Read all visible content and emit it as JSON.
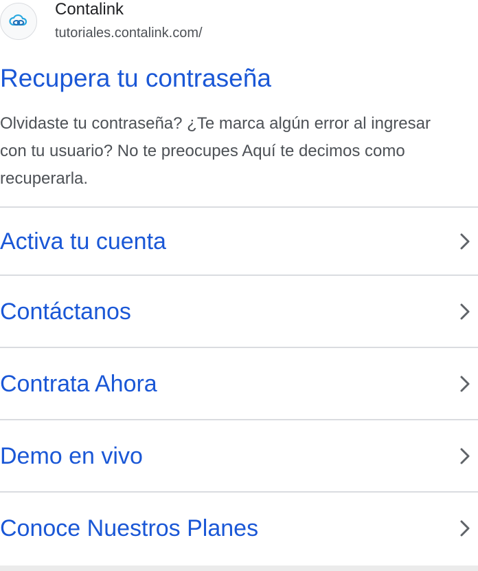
{
  "site": {
    "name": "Contalink",
    "url": "tutoriales.contalink.com/",
    "favicon_icon": "cloud-link-icon"
  },
  "result": {
    "title": "Recupera tu contraseña",
    "snippet": "Olvidaste tu contraseña? ¿Te marca algún error al ingresar con tu usuario? No te preocupes Aquí te decimos como recuperarla."
  },
  "sitelinks": [
    {
      "label": "Activa tu cuenta",
      "icon": "chevron-right-icon"
    },
    {
      "label": "Contáctanos",
      "icon": "chevron-right-icon"
    },
    {
      "label": "Contrata Ahora",
      "icon": "chevron-right-icon"
    },
    {
      "label": "Demo en vivo",
      "icon": "chevron-right-icon"
    },
    {
      "label": "Conoce Nuestros Planes",
      "icon": "chevron-right-icon"
    }
  ],
  "colors": {
    "link": "#1a57d6",
    "text": "#4d5156",
    "divider": "#dadce0",
    "favicon_accent": "#29a8e0"
  }
}
